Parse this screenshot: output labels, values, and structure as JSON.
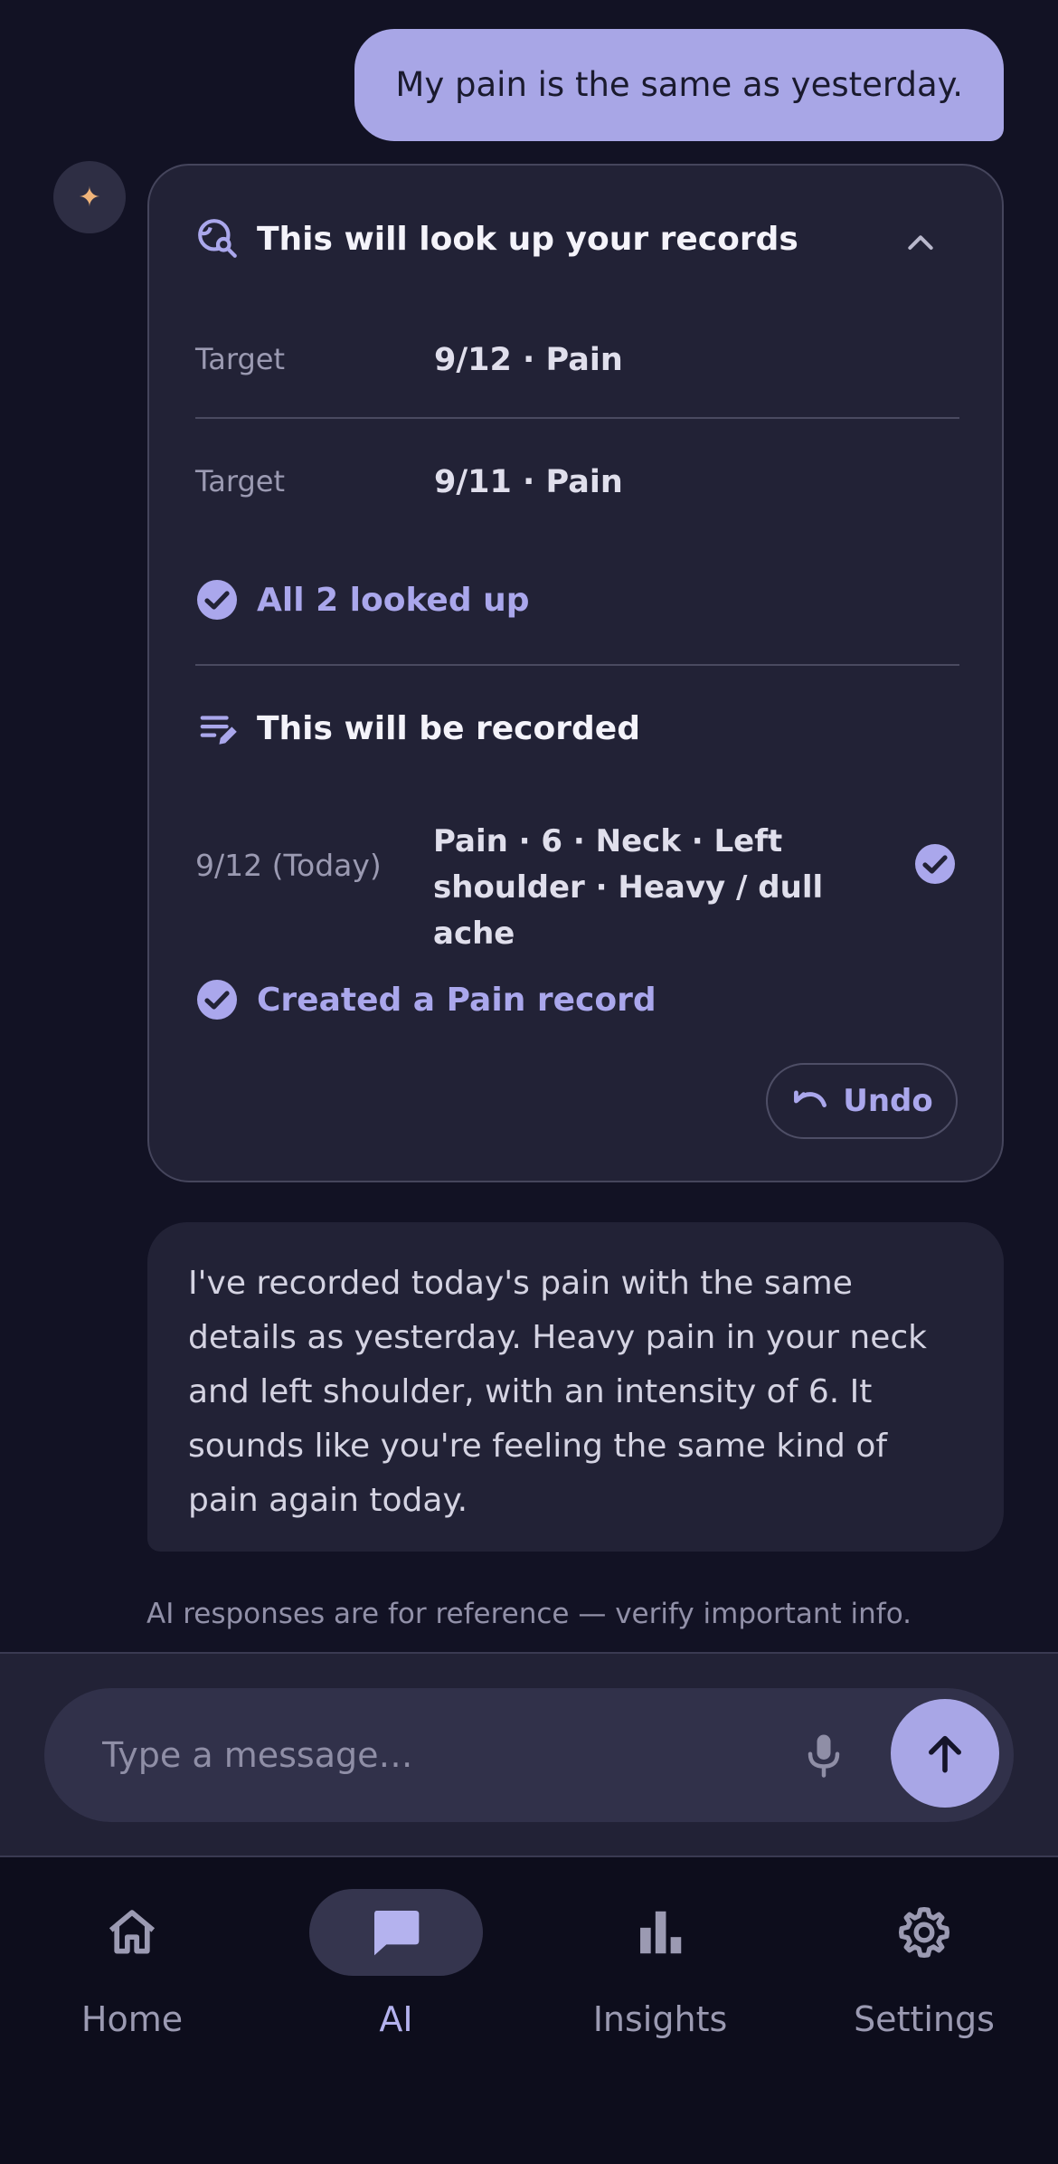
{
  "user_message": "My pain is the same as yesterday.",
  "assistant_avatar": {
    "icon": "sparkle-icon",
    "glyph": "✦"
  },
  "tool_card": {
    "lookup": {
      "title": "This will look up your records",
      "rows": [
        {
          "label": "Target",
          "value": "9/12 · Pain"
        },
        {
          "label": "Target",
          "value": "9/11 · Pain"
        }
      ],
      "status": "All 2 looked up"
    },
    "record": {
      "title": "This will be recorded",
      "date": "9/12 (Today)",
      "value": "Pain · 6 · Neck · Left shoulder · Heavy / dull ache",
      "status": "Created a Pain record"
    },
    "undo_label": "Undo"
  },
  "assistant_reply": "I've recorded today's pain with the same details as yesterday. Heavy pain in your neck and left shoulder, with an intensity of 6. It sounds like you're feeling the same kind of pain again today.",
  "disclaimer": "AI responses are for reference — verify important info.",
  "composer": {
    "placeholder": "Type a message…"
  },
  "nav": {
    "items": [
      {
        "label": "Home",
        "icon": "home-icon"
      },
      {
        "label": "AI",
        "icon": "chat-icon",
        "active": true
      },
      {
        "label": "Insights",
        "icon": "bar-chart-icon"
      },
      {
        "label": "Settings",
        "icon": "gear-icon"
      }
    ]
  },
  "colors": {
    "accent": "#a8a6e6",
    "background": "#121224",
    "card": "#222236",
    "nav": "#0d0d1c"
  }
}
